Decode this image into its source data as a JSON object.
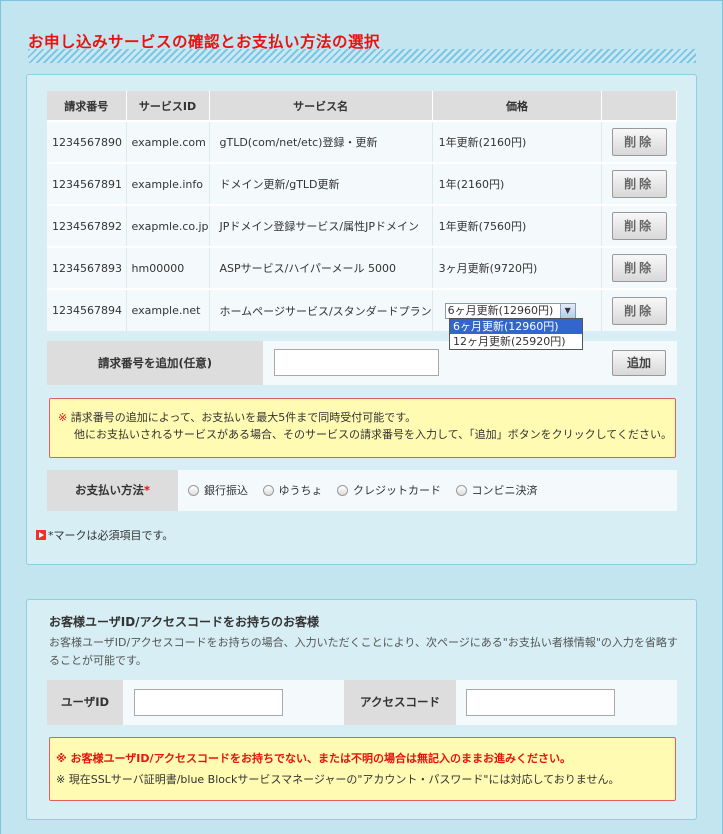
{
  "page": {
    "title": "お申し込みサービスの確認とお支払い方法の選択"
  },
  "service_table": {
    "headers": [
      "請求番号",
      "サービスID",
      "サービス名",
      "価格",
      ""
    ],
    "rows": [
      {
        "request_no": "1234567890",
        "service_id": "example.com",
        "service_name": "gTLD(com/net/etc)登録・更新",
        "price": "1年更新(2160円)",
        "delete_label": "削除"
      },
      {
        "request_no": "1234567891",
        "service_id": "example.info",
        "service_name": "ドメイン更新/gTLD更新",
        "price": "1年(2160円)",
        "delete_label": "削除"
      },
      {
        "request_no": "1234567892",
        "service_id": "exapmle.co.jp",
        "service_name": "JPドメイン登録サービス/属性JPドメイン",
        "price": "1年更新(7560円)",
        "delete_label": "削除"
      },
      {
        "request_no": "1234567893",
        "service_id": "hm00000",
        "service_name": "ASPサービス/ハイパーメール 5000",
        "price": "3ヶ月更新(9720円)",
        "delete_label": "削除"
      },
      {
        "request_no": "1234567894",
        "service_id": "example.net",
        "service_name": "ホームページサービス/スタンダードプラン",
        "price_select": "6ヶ月更新(12960円)",
        "delete_label": "削除"
      }
    ],
    "price_options": [
      "6ヶ月更新(12960円)",
      "12ヶ月更新(25920円)"
    ],
    "price_options_selected": 0
  },
  "add_request": {
    "label": "請求番号を追加(任意)",
    "value": "",
    "button_label": "追加"
  },
  "note1": {
    "mark": "※",
    "line1": "請求番号の追加によって、お支払いを最大5件まで同時受付可能です。",
    "line2": "他にお支払いされるサービスがある場合、そのサービスの請求番号を入力して、「追加」ボタンをクリックしてください。"
  },
  "payment": {
    "label": "お支払い方法",
    "required_mark": "*",
    "options": [
      "銀行振込",
      "ゆうちょ",
      "クレジットカード",
      "コンビニ決済"
    ]
  },
  "required_note": "*マークは必須項目です。",
  "account": {
    "heading": "お客様ユーザID/アクセスコードをお持ちのお客様",
    "description": "お客様ユーザID/アクセスコードをお持ちの場合、入力いただくことにより、次ページにある\"お支払い者様情報\"の入力を省略することが可能です。",
    "user_id_label": "ユーザID",
    "user_id_value": "",
    "access_code_label": "アクセスコード",
    "access_code_value": ""
  },
  "note2": {
    "line1": "※ お客様ユーザID/アクセスコードをお持ちでない、または不明の場合は無記入のままお進みください。",
    "line2": "※ 現在SSLサーバ証明書/blue Blockサービスマネージャーの\"アカウント・パスワード\"には対応しておりません。"
  },
  "colors": {
    "accent_red": "#e8130f",
    "page_bg": "#c2e5ef",
    "panel_bg": "#d6eef4",
    "note_bg": "#fffbb3"
  }
}
